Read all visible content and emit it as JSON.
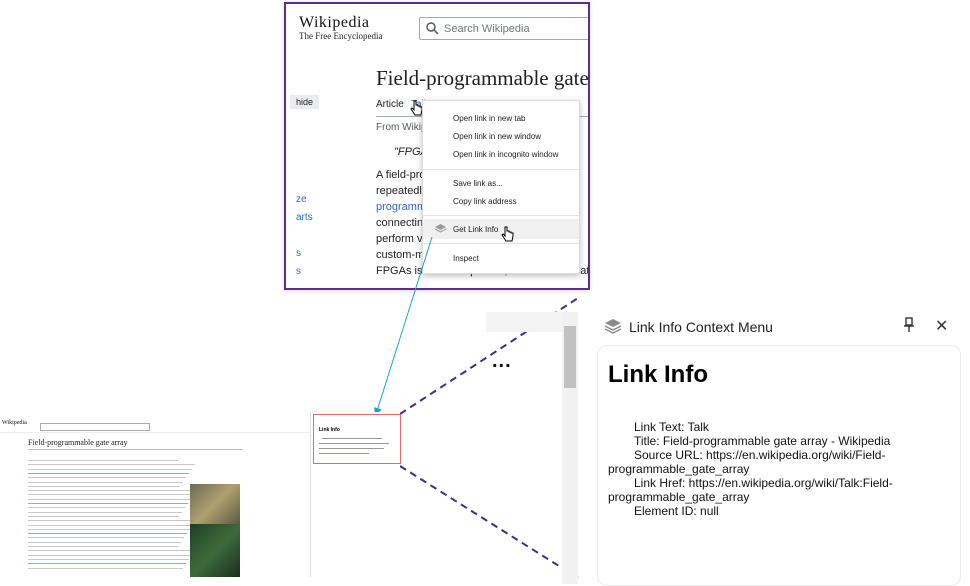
{
  "wiki": {
    "wordmark": "Wikipedia",
    "tagline": "The Free Encyclopedia",
    "search_placeholder": "Search Wikipedia",
    "article_title": "Field-programmable gate",
    "hide_label": "hide",
    "tab_article": "Article",
    "tab_talk": "Talk",
    "from_wiki": "From Wikipedia",
    "quote": "\"FPGA",
    "body_lines": [
      "A field-pro",
      "repeatedly",
      "programm",
      "connecting",
      "perform va",
      "custom-ma",
      "FPGAs is not as important, and where creating"
    ],
    "left_links": [
      "ze",
      "arts",
      "s",
      "s"
    ]
  },
  "context_menu": {
    "items": [
      "Open link in new tab",
      "Open link in new window",
      "Open link in incognito window",
      "Save link as...",
      "Copy link address",
      "Get Link Info",
      "Inspect"
    ]
  },
  "mini": {
    "title": "Field-programmable gate array",
    "popup_title": "Link Info"
  },
  "ellipsis": "...",
  "panel": {
    "title": "Link Info Context Menu",
    "heading": "Link Info",
    "lines": [
      "Link Text: Talk",
      "Title: Field-programmable gate array - Wikipedia",
      "Source URL: https://en.wikipedia.org/wiki/Field-",
      "programmable_gate_array",
      "Link Href: https://en.wikipedia.org/wiki/Talk:Field-",
      "programmable_gate_array",
      "Element ID: null"
    ]
  },
  "colors": {
    "zoom_border": "#5b2d8e",
    "arrow": "#1aa6c8",
    "dashed": "#3a2f8a",
    "popup_border": "#e06b6b",
    "link": "#3366cc"
  }
}
